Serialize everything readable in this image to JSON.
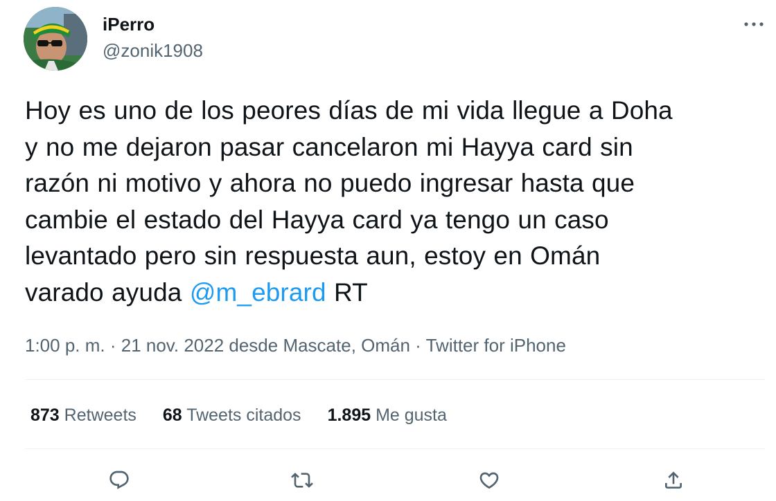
{
  "author": {
    "display_name": "iPerro",
    "handle": "@zonik1908"
  },
  "tweet": {
    "lines": [
      "Hoy es uno de los peores días de mi vida llegue a Doha",
      "y no me dejaron pasar cancelaron mi Hayya card sin",
      "razón ni motivo y ahora no puedo ingresar hasta que",
      "cambie el estado del Hayya card ya tengo un caso",
      "levantado pero sin respuesta aun, estoy en Omán"
    ],
    "last_line_before": "varado ayuda ",
    "mention": "@m_ebrard",
    "last_line_after": " RT"
  },
  "meta": {
    "time": "1:00 p. m.",
    "sep1": " · ",
    "date_location": "21 nov. 2022 desde Mascate, Omán",
    "sep2": " · ",
    "source": "Twitter for iPhone"
  },
  "stats": {
    "retweets_count": "873",
    "retweets_label": "Retweets",
    "quotes_count": "68",
    "quotes_label": "Tweets citados",
    "likes_count": "1.895",
    "likes_label": "Me gusta"
  },
  "icons": {
    "more": "more-horizontal-icon",
    "reply": "reply-icon",
    "retweet": "retweet-icon",
    "like": "heart-icon",
    "share": "share-icon"
  },
  "colors": {
    "text": "#0f1419",
    "secondary": "#536471",
    "link": "#1d9bf0",
    "divider": "#eff3f4"
  }
}
